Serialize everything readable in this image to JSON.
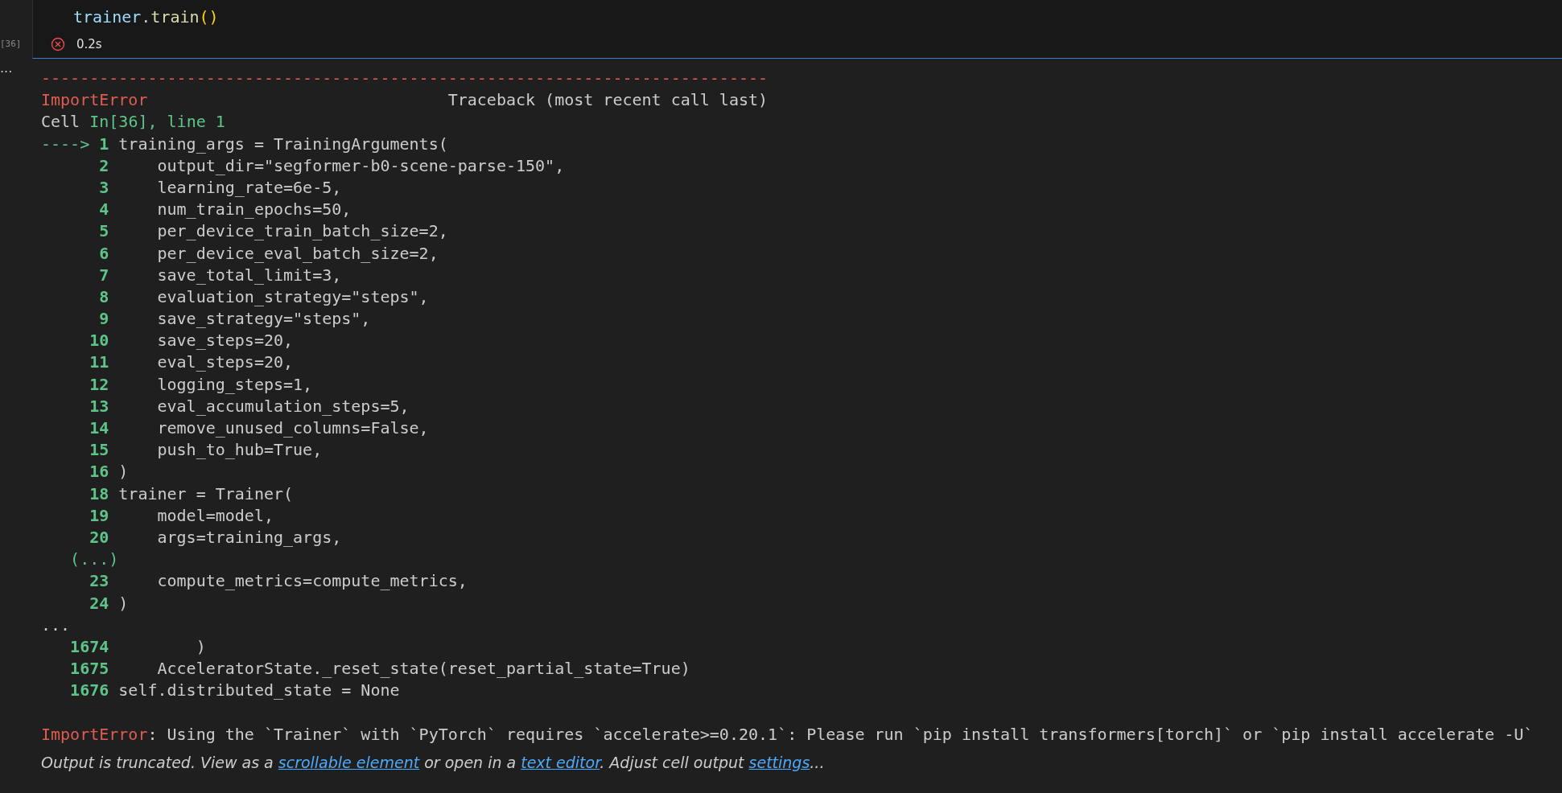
{
  "cell": {
    "execution_count": "[36]",
    "code": [
      {
        "kind": "variable",
        "text": "trainer"
      },
      {
        "kind": "plain",
        "text": "."
      },
      {
        "kind": "function",
        "text": "train"
      },
      {
        "kind": "bracket",
        "text": "()"
      }
    ],
    "status": {
      "failed": true,
      "duration": "0.2s"
    }
  },
  "output": {
    "more": "...",
    "lines": [
      {
        "kind": "rule",
        "text": "---------------------------------------------------------------------------"
      },
      {
        "kind": "header",
        "name": "ImportError",
        "text": "Traceback (most recent call last)"
      },
      {
        "kind": "location",
        "prefix": "Cell ",
        "text": "In[36], line 1"
      },
      {
        "kind": "code",
        "arrow": "---->",
        "number": "1",
        "code": "training_args = TrainingArguments("
      },
      {
        "kind": "code",
        "number": "2",
        "code": "    output_dir=\"segformer-b0-scene-parse-150\","
      },
      {
        "kind": "code",
        "number": "3",
        "code": "    learning_rate=6e-5,"
      },
      {
        "kind": "code",
        "number": "4",
        "code": "    num_train_epochs=50,"
      },
      {
        "kind": "code",
        "number": "5",
        "code": "    per_device_train_batch_size=2,"
      },
      {
        "kind": "code",
        "number": "6",
        "code": "    per_device_eval_batch_size=2,"
      },
      {
        "kind": "code",
        "number": "7",
        "code": "    save_total_limit=3,"
      },
      {
        "kind": "code",
        "number": "8",
        "code": "    evaluation_strategy=\"steps\","
      },
      {
        "kind": "code",
        "number": "9",
        "code": "    save_strategy=\"steps\","
      },
      {
        "kind": "code",
        "number": "10",
        "code": "    save_steps=20,"
      },
      {
        "kind": "code",
        "number": "11",
        "code": "    eval_steps=20,"
      },
      {
        "kind": "code",
        "number": "12",
        "code": "    logging_steps=1,"
      },
      {
        "kind": "code",
        "number": "13",
        "code": "    eval_accumulation_steps=5,"
      },
      {
        "kind": "code",
        "number": "14",
        "code": "    remove_unused_columns=False,"
      },
      {
        "kind": "code",
        "number": "15",
        "code": "    push_to_hub=True,"
      },
      {
        "kind": "code",
        "number": "16",
        "code": ")"
      },
      {
        "kind": "code",
        "number": "18",
        "code": "trainer = Trainer("
      },
      {
        "kind": "code",
        "number": "19",
        "code": "    model=model,"
      },
      {
        "kind": "code",
        "number": "20",
        "code": "    args=training_args,"
      },
      {
        "kind": "skip",
        "text": "(...)"
      },
      {
        "kind": "code",
        "number": "23",
        "code": "    compute_metrics=compute_metrics,"
      },
      {
        "kind": "code",
        "number": "24",
        "code": ")"
      },
      {
        "kind": "plain",
        "text": "..."
      },
      {
        "kind": "code",
        "number": "1674",
        "code": "        )"
      },
      {
        "kind": "code",
        "number": "1675",
        "code": "    AcceleratorState._reset_state(reset_partial_state=True)"
      },
      {
        "kind": "code",
        "number": "1676",
        "code": "self.distributed_state = None"
      },
      {
        "kind": "blank"
      },
      {
        "kind": "error",
        "name": "ImportError",
        "text": ": Using the `Trainer` with `PyTorch` requires `accelerate>=0.20.1`: Please run `pip install transformers[torch]` or `pip install accelerate -U`"
      }
    ],
    "note": [
      {
        "kind": "text",
        "text": "Output is truncated. View as a "
      },
      {
        "kind": "link",
        "text": "scrollable element"
      },
      {
        "kind": "text",
        "text": " or open in a "
      },
      {
        "kind": "link",
        "text": "text editor"
      },
      {
        "kind": "text",
        "text": ". Adjust cell output "
      },
      {
        "kind": "link",
        "text": "settings"
      },
      {
        "kind": "text",
        "text": "..."
      }
    ]
  }
}
